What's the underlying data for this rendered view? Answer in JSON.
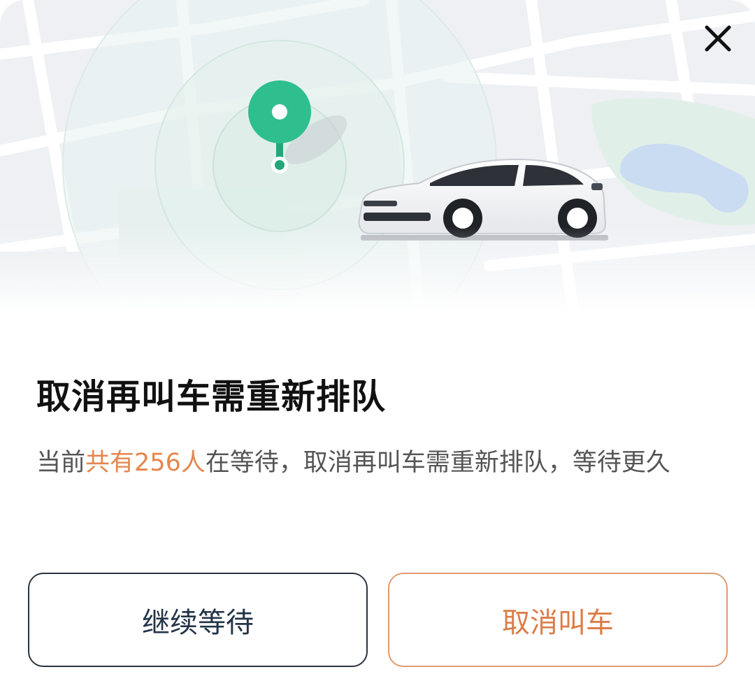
{
  "dialog": {
    "title": "取消再叫车需重新排队",
    "message": {
      "prefix": "当前",
      "highlight_prefix": "共有",
      "waiting_count": "256",
      "highlight_suffix": "人",
      "suffix": "在等待，取消再叫车需重新排队，等待更久"
    },
    "close_icon": "close-icon",
    "illustration": {
      "pin_icon": "location-pin-icon",
      "car_icon": "car-icon"
    }
  },
  "buttons": {
    "continue_label": "继续等待",
    "cancel_label": "取消叫车"
  },
  "colors": {
    "accent_orange": "#dc7d48",
    "pin_green": "#2fbf8f",
    "text_dark": "#111111",
    "button_dark": "#243447"
  }
}
